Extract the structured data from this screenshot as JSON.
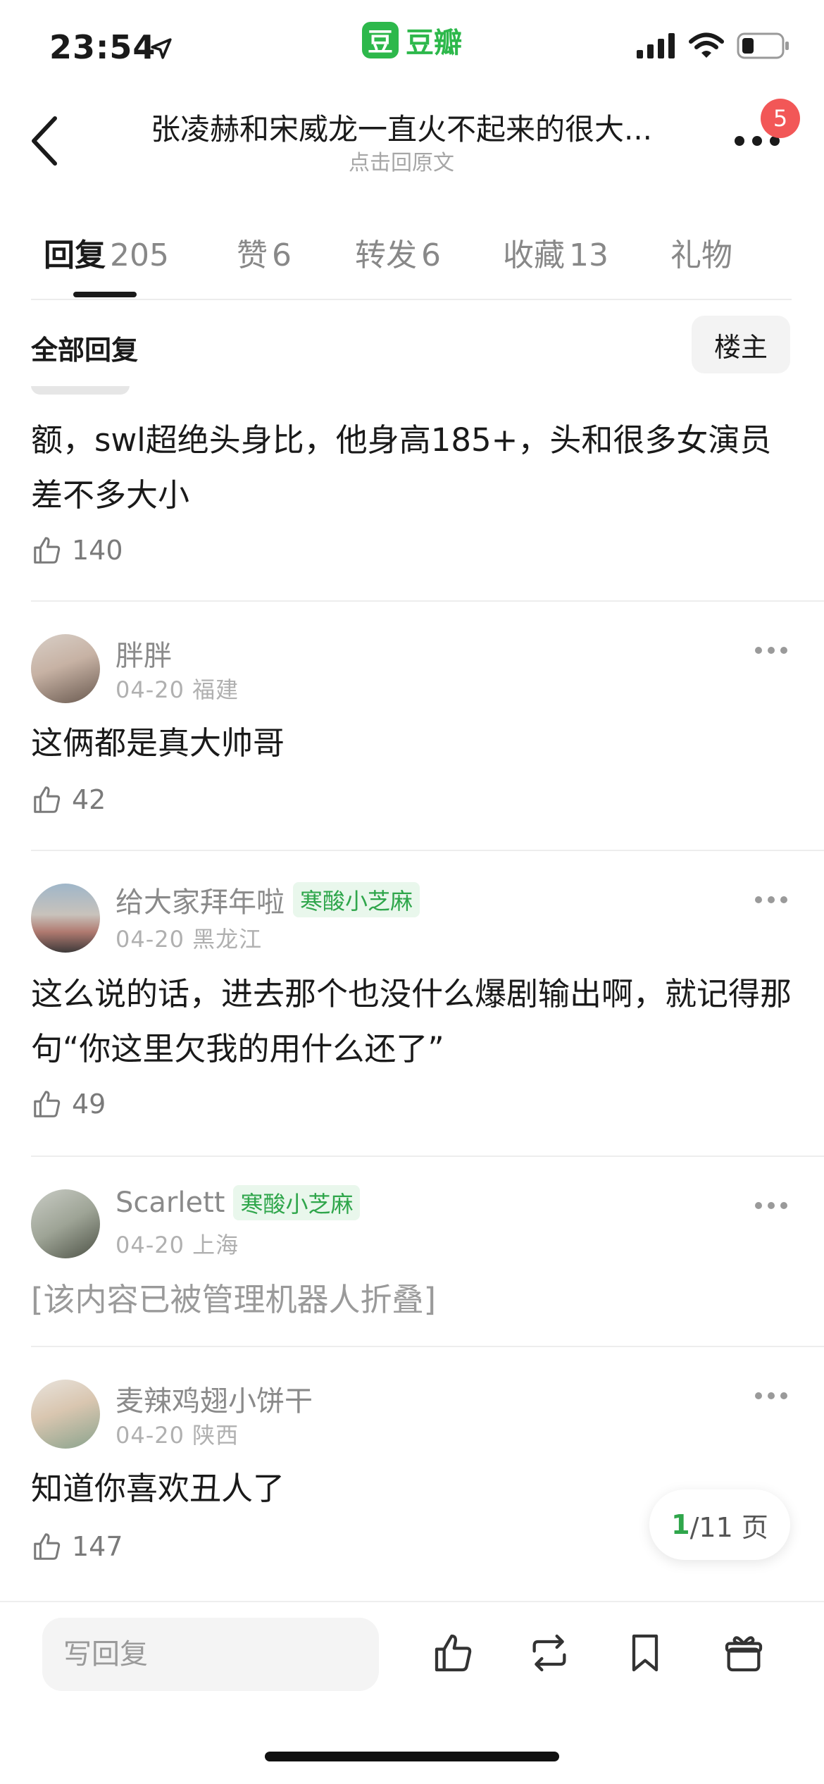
{
  "status_bar": {
    "time": "23:54"
  },
  "app": {
    "logo_char": "豆",
    "name": "豆瓣"
  },
  "nav": {
    "title": "张凌赫和宋威龙一直火不起来的很大...",
    "subtitle": "点击回原文",
    "notification_count": "5"
  },
  "tabs": [
    {
      "label": "回复",
      "count": "205"
    },
    {
      "label": "赞",
      "count": "6"
    },
    {
      "label": "转发",
      "count": "6"
    },
    {
      "label": "收藏",
      "count": "13"
    },
    {
      "label": "礼物",
      "count": ""
    }
  ],
  "filter": {
    "label": "全部回复",
    "op_button": "楼主"
  },
  "comments": [
    {
      "text": "额，swl超绝头身比，他身高185+，头和很多女演员差不多大小",
      "likes": "140"
    },
    {
      "user": "胖胖",
      "date": "04-20",
      "location": "福建",
      "tag": "",
      "text": "这俩都是真大帅哥",
      "likes": "42"
    },
    {
      "user": "给大家拜年啦",
      "date": "04-20",
      "location": "黑龙江",
      "tag": "寒酸小芝麻",
      "text": "这么说的话，进去那个也没什么爆剧输出啊，就记得那句“你这里欠我的用什么还了”",
      "likes": "49"
    },
    {
      "user": "Scarlett",
      "date": "04-20",
      "location": "上海",
      "tag": "寒酸小芝麻",
      "text": "[该内容已被管理机器人折叠]",
      "likes": ""
    },
    {
      "user": "麦辣鸡翅小饼干",
      "date": "04-20",
      "location": "陕西",
      "tag": "",
      "text": "知道你喜欢丑人了",
      "likes": "147"
    }
  ],
  "pagination": {
    "current": "1",
    "total_text": "/11 页"
  },
  "bottom_bar": {
    "reply_placeholder": "写回复"
  },
  "colors": {
    "brand_green": "#2db84b",
    "badge_red": "#f25757",
    "tag_green": "#2fa64b"
  }
}
